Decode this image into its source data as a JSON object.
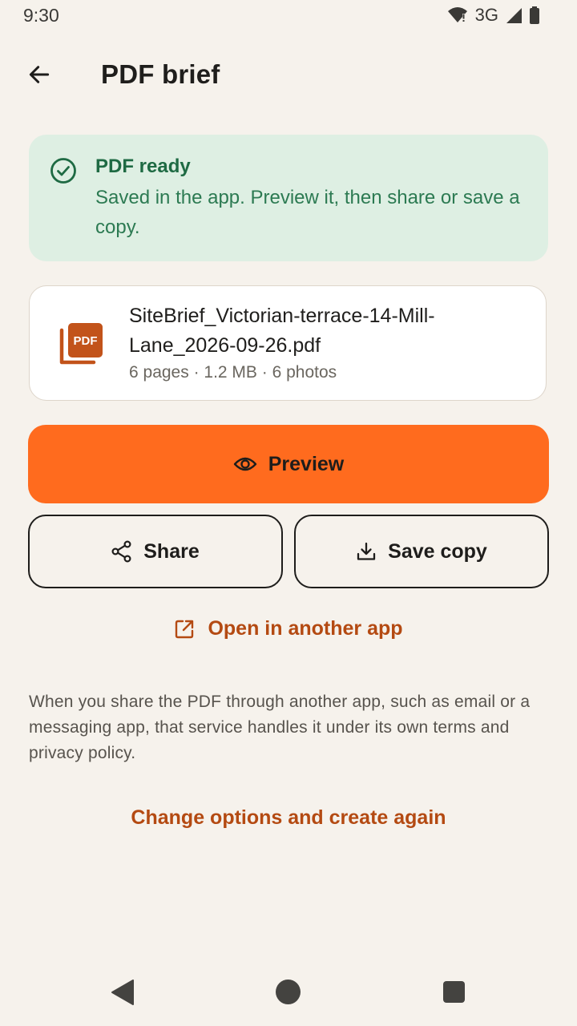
{
  "status_bar": {
    "time": "9:30",
    "network": "3G",
    "icons": [
      "wifi-alert-icon",
      "signal-icon",
      "battery-icon"
    ]
  },
  "top_bar": {
    "back_icon": "arrow-left-icon",
    "title": "PDF brief"
  },
  "banner": {
    "icon": "check-circle-icon",
    "title": "PDF ready",
    "message": "Saved in the app. Preview it, then share or save a copy.",
    "colors": {
      "background": "#DEEFE3",
      "text": "#1E6A43"
    }
  },
  "file": {
    "icon": "pdf-file-icon",
    "name": "SiteBrief_Victorian-terrace-14-Mill-Lane_2026-09-26.pdf",
    "meta": "6 pages · 1.2 MB · 6 photos",
    "icon_badge": "PDF"
  },
  "actions": {
    "preview_label": "Preview",
    "preview_icon": "eye-icon",
    "share_label": "Share",
    "share_icon": "share-icon",
    "save_label": "Save copy",
    "save_icon": "download-icon",
    "open_label": "Open in another app",
    "open_icon": "open-external-icon"
  },
  "notice": "When you share the PDF through another app, such as email or a messaging app, that service handles it under its own terms and privacy policy.",
  "change_link": "Change options and create again",
  "colors": {
    "background": "#F6F2EC",
    "accent": "#FF6B1E",
    "link": "#B44A12"
  },
  "nav_bar": {
    "icons": [
      "nav-back-icon",
      "nav-home-icon",
      "nav-recents-icon"
    ]
  }
}
